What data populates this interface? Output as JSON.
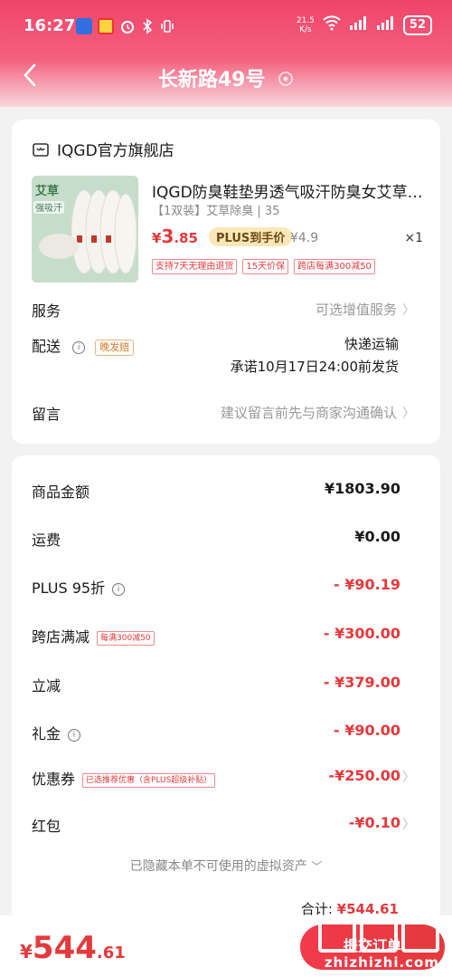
{
  "status_bar": {
    "time": "16:27",
    "net_speed_value": "21.5",
    "net_speed_unit": "K/s",
    "battery": "52",
    "icons": [
      "app-notification-icon",
      "red-app-icon",
      "alarm-icon",
      "bluetooth-icon",
      "vibrate-icon",
      "wifi-icon",
      "signal-icon",
      "signal-icon-2"
    ]
  },
  "nav": {
    "back_icon": "chevron-left-icon",
    "title": "长新路49号",
    "location_icon": "location-pin-icon"
  },
  "store": {
    "name": "IQGD官方旗舰店",
    "store_icon": "shop-icon",
    "product": {
      "title": "IQGD防臭鞋垫男透气吸汗防臭女艾草…",
      "image_text_1": "艾草",
      "image_text_2": "强吸汗",
      "spec": "【1双装】艾草除臭 | 35",
      "price_symbol": "¥",
      "price_int": "3",
      "price_dec": ".85",
      "plus_tag": "PLUS到手价",
      "original_price": "¥4.9",
      "quantity": "×1",
      "badges": [
        "支持7天无理由退货",
        "15天价保",
        "跨店每满300减50"
      ]
    },
    "service_label": "服务",
    "service_value": "可选增值服务",
    "delivery_label": "配送",
    "delivery_tag": "晚发赔",
    "delivery_method": "快递运输",
    "delivery_promise": "承诺10月17日24:00前发货",
    "message_label": "留言",
    "message_placeholder": "建议留言前先与商家沟通确认"
  },
  "summary": {
    "rows": [
      {
        "label": "商品金额",
        "value": "¥1803.90",
        "red": false
      },
      {
        "label": "运费",
        "value": "¥0.00",
        "red": false
      },
      {
        "label": "PLUS 95折",
        "value": "- ¥90.19",
        "red": true
      },
      {
        "label": "跨店满减",
        "tag": "每满300减50",
        "value": "- ¥300.00",
        "red": true
      },
      {
        "label": "立减",
        "value": "- ¥379.00",
        "red": true
      },
      {
        "label": "礼金",
        "value": "- ¥90.00",
        "red": true
      },
      {
        "label": "优惠券",
        "tag": "已选推荐优惠（含PLUS超级补贴）",
        "value": "-¥250.00",
        "red": true
      },
      {
        "label": "红包",
        "value": "-¥0.10",
        "red": true
      }
    ],
    "hidden_note": "已隐藏本单不可使用的虚拟资产",
    "total_label": "合计:",
    "total_value": "¥544.61"
  },
  "bottom": {
    "price_symbol": "¥",
    "price_int": "544",
    "price_dec": ".61",
    "submit_label": "提交订单"
  },
  "watermark": {
    "text": "zhizhizhi.com"
  },
  "colors": {
    "accent_red": "#e4393c",
    "header_pink": "#f0446a",
    "plus_gold": "#fbe7b8"
  }
}
